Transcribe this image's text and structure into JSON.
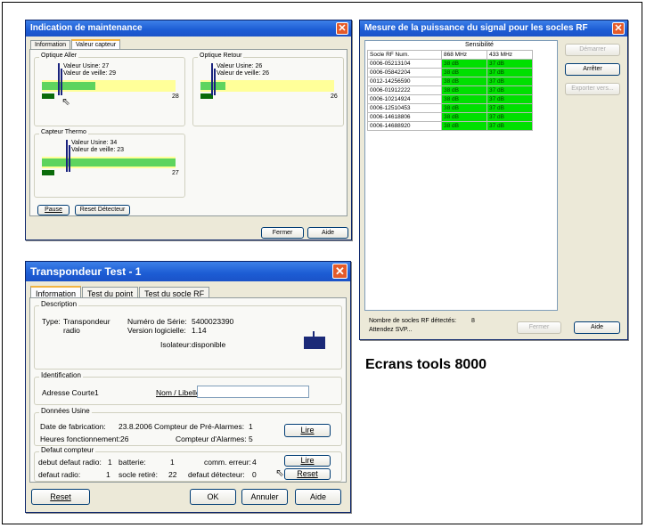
{
  "caption": "Ecrans tools 8000",
  "win1": {
    "title": "Indication de maintenance",
    "tabs": [
      "Information",
      "Valeur capteur"
    ],
    "groups": [
      {
        "label": "Optique Aller",
        "usine": "Valeur Usine: 27",
        "veille": "Valeur de veille: 29",
        "num": "28"
      },
      {
        "label": "Optique Retour",
        "usine": "Valeur Usine: 26",
        "veille": "Valeur de veille: 26",
        "num": "26"
      },
      {
        "label": "Capteur Thermo",
        "usine": "Valeur Usine: 34",
        "veille": "Valeur de veille: 23",
        "num": "27"
      }
    ],
    "pause": "Pause",
    "reset": "Reset Détecteur",
    "fermer": "Fermer",
    "aide": "Aide"
  },
  "win2": {
    "title": "Mesure de la puissance du signal pour les socles RF",
    "sensibilite": "Sensibilité",
    "headers": [
      "Socle RF Num.",
      "868 MHz",
      "433 MHz"
    ],
    "rows": [
      [
        "0006-05213104",
        "38 dB",
        "37 dB"
      ],
      [
        "0006-05842204",
        "38 dB",
        "37 dB"
      ],
      [
        "0012-14256590",
        "38 dB",
        "37 dB"
      ],
      [
        "0006-01912222",
        "38 dB",
        "37 dB"
      ],
      [
        "0006-10214924",
        "38 dB",
        "37 dB"
      ],
      [
        "0006-12510453",
        "38 dB",
        "37 dB"
      ],
      [
        "0006-14618806",
        "38 dB",
        "37 dB"
      ],
      [
        "0006-14688920",
        "38 dB",
        "37 dB"
      ]
    ],
    "demarrer": "Démarrer",
    "arreter": "Arrêter",
    "exporter": "Exporter vers...",
    "nombre_label": "Nombre de socles RF détectés:",
    "nombre": "8",
    "attendez": "Attendez SVP...",
    "fermer": "Fermer",
    "aide": "Aide"
  },
  "win3": {
    "title": "Transpondeur Test - 1",
    "tabs": [
      "Information",
      "Test du point",
      "Test du socle RF"
    ],
    "desc": {
      "label": "Description",
      "type_label": "Type:",
      "type_val": "Transpondeur radio",
      "serie_label": "Numéro de Série:",
      "serie_val": "5400023390",
      "version_label": "Version logicielle:",
      "version_val": "1.14",
      "isolateur_label": "Isolateur:",
      "isolateur_val": "disponible"
    },
    "ident": {
      "label": "Identification",
      "adresse": "Adresse Courte1",
      "nom_label": "Nom / Libellé:",
      "nom_val": ""
    },
    "usine": {
      "label": "Données Usine",
      "date_label": "Date de fabrication:",
      "date_val": "23.8.2006",
      "heures_label": "Heures fonctionnement:",
      "heures_val": "26",
      "prealarmes_label": "Compteur de Pré-Alarmes:",
      "prealarmes_val": "1",
      "alarmes_label": "Compteur d'Alarmes:",
      "alarmes_val": "5",
      "lire": "Lire"
    },
    "defaut": {
      "label": "Defaut compteur",
      "r1a": "debut defaut radio:",
      "r1b": "1",
      "r1c": "batterie:",
      "r1d": "1",
      "r1e": "comm. erreur:",
      "r1f": "4",
      "r2a": "defaut radio:",
      "r2b": "1",
      "r2c": "socle retiré:",
      "r2d": "22",
      "r2e": "defaut détecteur:",
      "r2f": "0",
      "lire": "Lire",
      "reset": "Reset"
    },
    "reset": "Reset",
    "ok": "OK",
    "annuler": "Annuler",
    "aide": "Aide"
  }
}
